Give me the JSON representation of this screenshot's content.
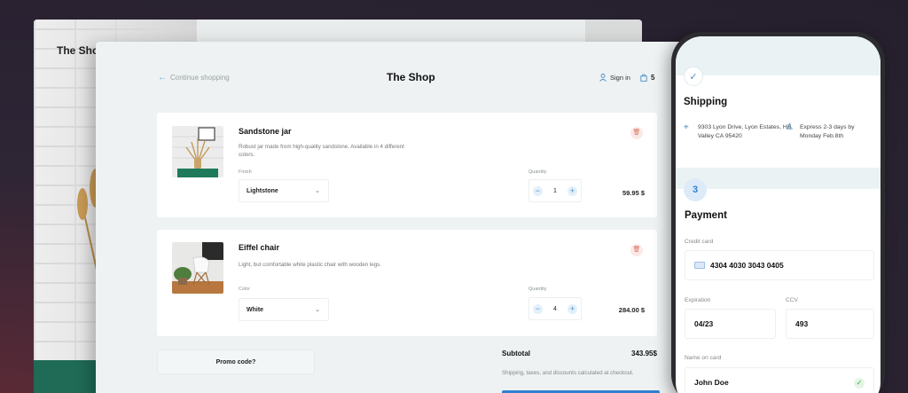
{
  "back_window": {
    "title": "The Shop"
  },
  "header": {
    "continue_label": "Continue shopping",
    "title": "The Shop",
    "signin_label": "Sign in",
    "cart_count": "5"
  },
  "cart": {
    "items": [
      {
        "name": "Sandstone jar",
        "description": "Robust jar made from high-quality sandstone. Available in 4 different colors.",
        "option_label": "Finish",
        "option_value": "Lightstone",
        "quantity_label": "Quantity",
        "quantity": "1",
        "price": "59.95 $"
      },
      {
        "name": "Eiffel chair",
        "description": "Light, but comfortable white plastic chair with wooden legs.",
        "option_label": "Color",
        "option_value": "White",
        "quantity_label": "Quantity",
        "quantity": "4",
        "price": "284.00 $"
      }
    ],
    "promo_label": "Promo code?",
    "subtotal_label": "Subtotal",
    "subtotal_value": "343.95$",
    "subtotal_note": "Shipping, taxes, and discounts calculated at checkout."
  },
  "phone": {
    "shipping": {
      "title": "Shipping",
      "address": "9303 Lyon Drive, Lyon Estates, Hill Valley CA 95420",
      "delivery": "Express 2-3 days by Monday Feb.8th"
    },
    "payment": {
      "step": "3",
      "title": "Payment",
      "card_label": "Credit card",
      "card_number": "4304 4030 3043 0405",
      "expiration_label": "Expiration",
      "expiration_value": "04/23",
      "ccv_label": "CCV",
      "ccv_value": "493",
      "name_label": "Name on card",
      "name_value": "John Doe"
    }
  },
  "colors": {
    "accent": "#2f7fd3",
    "icon_blue": "#4a90c8",
    "delete_red": "#d97664",
    "ok_green": "#6cbf6c"
  }
}
